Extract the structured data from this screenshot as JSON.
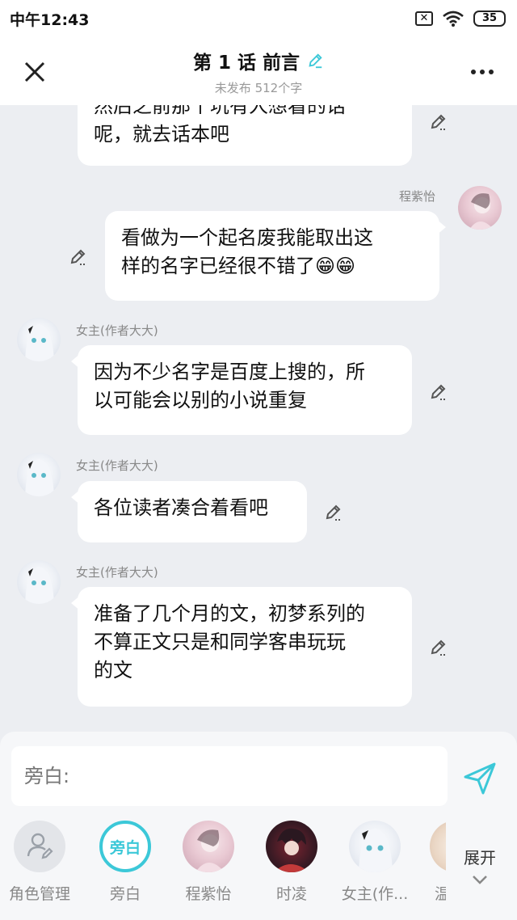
{
  "status_bar": {
    "time": "中午12:43",
    "battery": "35"
  },
  "header": {
    "title": "第 1 话 前言",
    "subtitle": "未发布 512个字"
  },
  "messages": [
    {
      "side": "left",
      "text": "然后之前那个坑有人想看的话\n呢，就去话本吧"
    },
    {
      "side": "right",
      "name": "程紫怡",
      "text": "看做为一个起名废我能取出这\n样的名字已经很不错了😁😁"
    },
    {
      "side": "left",
      "name": "女主(作者大大)",
      "text": "因为不少名字是百度上搜的，所\n以可能会以别的小说重复"
    },
    {
      "side": "left",
      "name": "女主(作者大大)",
      "text": "各位读者凑合着看吧"
    },
    {
      "side": "left",
      "name": "女主(作者大大)",
      "text": "准备了几个月的文，初梦系列的\n不算正文只是和同学客串玩玩\n的文"
    }
  ],
  "input": {
    "placeholder": "旁白:"
  },
  "roles": [
    {
      "label": "角色管理"
    },
    {
      "label": "旁白",
      "circle_text": "旁白"
    },
    {
      "label": "程紫怡"
    },
    {
      "label": "时凌"
    },
    {
      "label": "女主(作..."
    },
    {
      "label": "温"
    }
  ],
  "expand": {
    "label": "展开"
  },
  "colors": {
    "accent": "#3cc8d8",
    "background": "#eceef2"
  }
}
